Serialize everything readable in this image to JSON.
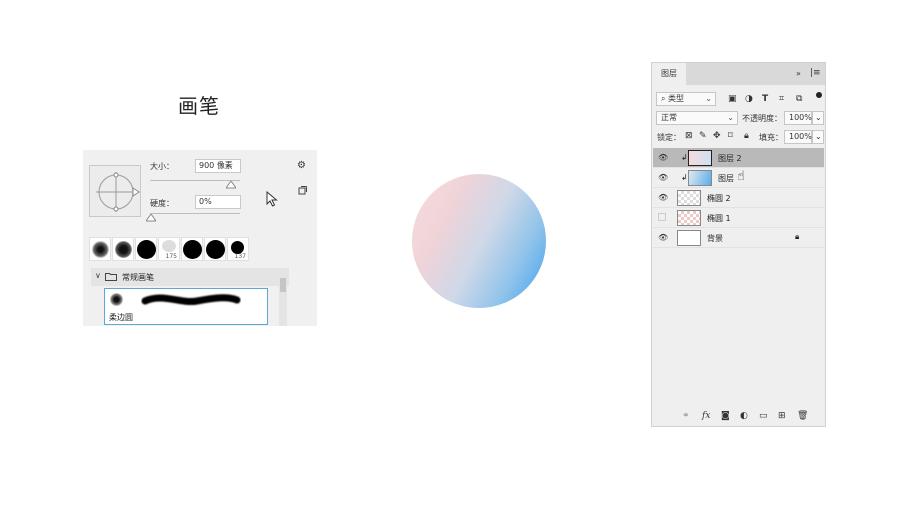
{
  "title": "画笔",
  "brush": {
    "size_label": "大小：",
    "size_value": "900 像素",
    "hardness_label": "硬度：",
    "hardness_value": "0%",
    "gear": "⚙",
    "swatches": [
      {
        "num": ""
      },
      {
        "num": ""
      },
      {
        "num": ""
      },
      {
        "num": "175"
      },
      {
        "num": ""
      },
      {
        "num": ""
      },
      {
        "num": "137"
      }
    ],
    "group_label": "常规画笔",
    "brush_name": "柔边圆"
  },
  "layers": {
    "tab": "图层",
    "filter_kind": "类型",
    "blend_mode": "正常",
    "opacity_label": "不透明度：",
    "opacity_value": "100%",
    "lock_label": "锁定：",
    "fill_label": "填充：",
    "fill_value": "100%",
    "rows": [
      {
        "name": "图层 2"
      },
      {
        "name": "图层"
      },
      {
        "name": "椭圆 2"
      },
      {
        "name": "椭圆 1"
      },
      {
        "name": "背景"
      }
    ]
  }
}
